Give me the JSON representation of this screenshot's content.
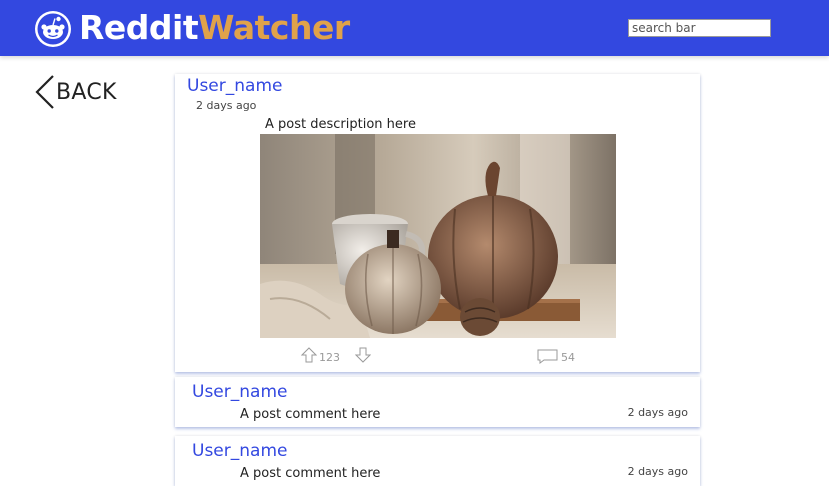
{
  "header": {
    "brand_part1": "Reddit",
    "brand_part2": "Watcher",
    "logo_icon": "reddit-alien-icon",
    "search_placeholder": "search bar",
    "bg_color": "#3348e0",
    "accent_color": "#e0a24a"
  },
  "back": {
    "label": "BACK",
    "icon": "chevron-left-icon"
  },
  "post": {
    "user": "User_name",
    "time": "2 days ago",
    "description": "A post description here",
    "image_alt": "pumpkins-photo",
    "upvotes": "123",
    "comments": "54"
  },
  "comments": [
    {
      "user": "User_name",
      "text": "A post comment here",
      "time": "2 days ago"
    },
    {
      "user": "User_name",
      "text": "A post comment here",
      "time": "2 days ago"
    }
  ]
}
